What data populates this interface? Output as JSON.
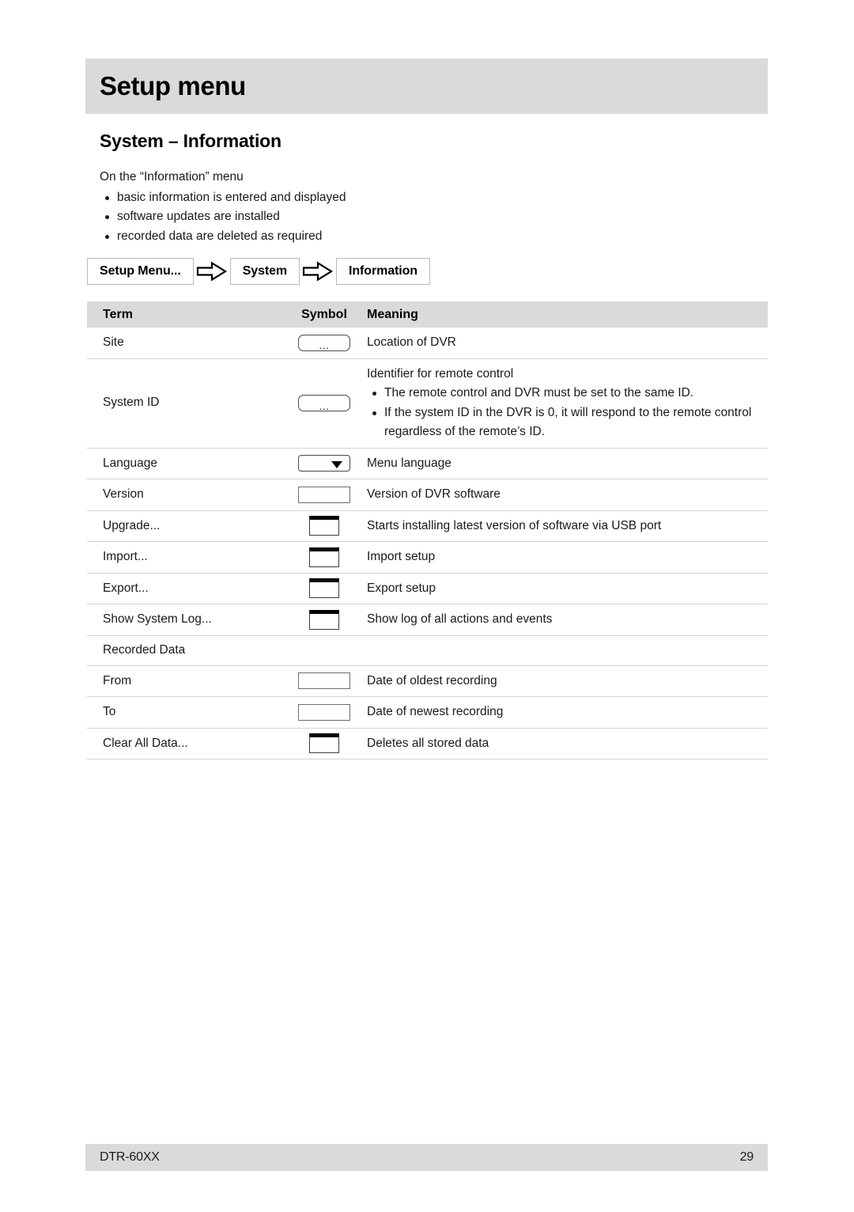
{
  "chapter": {
    "title": "Setup menu"
  },
  "section": {
    "heading": "System – Information",
    "intro_line": "On the “Information” menu",
    "intro_bullets": [
      "basic information is entered and displayed",
      "software updates are installed",
      "recorded data are deleted as required"
    ]
  },
  "breadcrumb": {
    "arrow_icon": "right-block-arrow-icon",
    "items": [
      {
        "label": "Setup Menu..."
      },
      {
        "label": "System"
      },
      {
        "label": "Information"
      }
    ]
  },
  "table": {
    "headers": {
      "term": "Term",
      "symbol": "Symbol",
      "meaning": "Meaning"
    },
    "rows": [
      {
        "term": "Site",
        "symbol": "ellipsis-field-icon",
        "symbol_text": "...",
        "meaning": "Location of DVR",
        "meaning_bullets": []
      },
      {
        "term": "System ID",
        "symbol": "ellipsis-field-icon",
        "symbol_text": "...",
        "meaning": "Identifier for remote control",
        "meaning_bullets": [
          "The remote control and DVR must be set to the same ID.",
          "If the system ID in the DVR is 0, it will respond to the remote control regardless of the remote’s ID."
        ]
      },
      {
        "term": "Language",
        "symbol": "dropdown-select-icon",
        "symbol_text": "",
        "meaning": "Menu language",
        "meaning_bullets": []
      },
      {
        "term": "Version",
        "symbol": "text-field-icon",
        "symbol_text": "",
        "meaning": "Version of DVR software",
        "meaning_bullets": []
      },
      {
        "term": "Upgrade...",
        "symbol": "push-button-icon",
        "symbol_text": "",
        "meaning": "Starts installing latest version of software via USB port",
        "meaning_bullets": []
      },
      {
        "term": "Import...",
        "symbol": "push-button-icon",
        "symbol_text": "",
        "meaning": "Import setup",
        "meaning_bullets": []
      },
      {
        "term": "Export...",
        "symbol": "push-button-icon",
        "symbol_text": "",
        "meaning": "Export setup",
        "meaning_bullets": []
      },
      {
        "term": "Show System Log...",
        "symbol": "push-button-icon",
        "symbol_text": "",
        "meaning": "Show log of all actions and events",
        "meaning_bullets": []
      },
      {
        "term": "Recorded Data",
        "symbol": "none",
        "symbol_text": "",
        "meaning": "",
        "meaning_bullets": []
      },
      {
        "term": "From",
        "symbol": "text-field-icon",
        "symbol_text": "",
        "meaning": "Date of oldest recording",
        "meaning_bullets": []
      },
      {
        "term": "To",
        "symbol": "text-field-icon",
        "symbol_text": "",
        "meaning": "Date of newest recording",
        "meaning_bullets": []
      },
      {
        "term": "Clear All Data...",
        "symbol": "push-button-icon",
        "symbol_text": "",
        "meaning": "Deletes all stored data",
        "meaning_bullets": []
      }
    ]
  },
  "footer": {
    "model": "DTR-60XX",
    "page_number": "29"
  },
  "colors": {
    "band_gray": "#d9dadb",
    "rule_gray": "#d3d4d5",
    "text": "#1a1a1a"
  }
}
